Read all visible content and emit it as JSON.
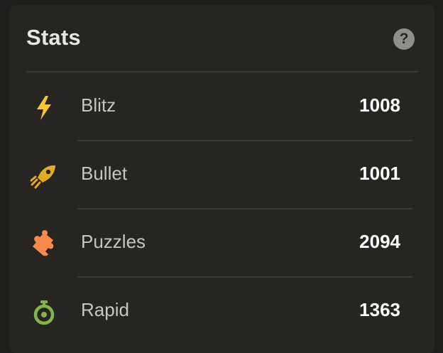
{
  "stats": {
    "title": "Stats",
    "help_icon": "?",
    "rows": [
      {
        "icon": "lightning-bolt-icon",
        "label": "Blitz",
        "rating": "1008",
        "color": "#f7c631"
      },
      {
        "icon": "bullet-rocket-icon",
        "label": "Bullet",
        "rating": "1001",
        "color": "#e3aa24"
      },
      {
        "icon": "puzzle-piece-icon",
        "label": "Puzzles",
        "rating": "2094",
        "color": "#f7894a"
      },
      {
        "icon": "stopwatch-icon",
        "label": "Rapid",
        "rating": "1363",
        "color": "#81b64c"
      }
    ]
  }
}
